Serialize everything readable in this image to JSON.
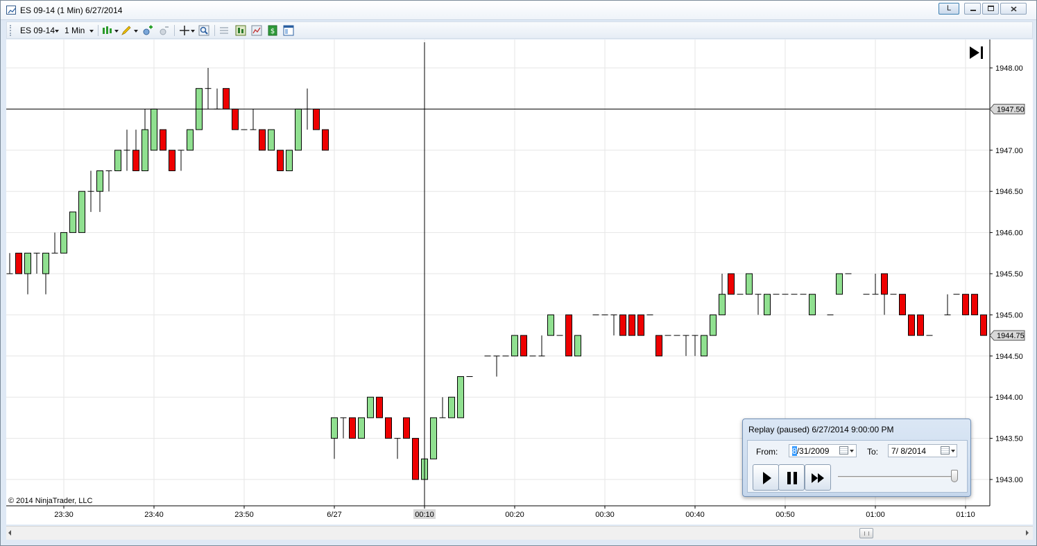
{
  "window": {
    "title": "ES 09-14 (1 Min)  6/27/2014",
    "buttons": {
      "layout": "L"
    }
  },
  "toolbar": {
    "instrument": "ES 09-14",
    "interval": "1 Min",
    "icons": [
      "chart-style-icon",
      "drawing-pencil-icon",
      "add-indicator-icon",
      "remove-indicator-icon",
      "crosshair-icon",
      "zoom-icon",
      "properties-icon",
      "data-box-icon",
      "strategy-icon",
      "money-icon",
      "layout-icon"
    ]
  },
  "chart": {
    "copyright": "© 2014 NinjaTrader, LLC",
    "price_labels": [
      "1948.00",
      "1947.50",
      "1947.00",
      "1946.50",
      "1946.00",
      "1945.50",
      "1945.00",
      "1944.50",
      "1944.00",
      "1943.50",
      "1943.00"
    ],
    "time_labels": [
      "23:30",
      "23:40",
      "23:50",
      "6/27",
      "00:10",
      "00:20",
      "00:30",
      "00:40",
      "00:50",
      "01:00",
      "01:10"
    ],
    "crosshair_price": "1947.50",
    "last_price": "1944.75",
    "colors": {
      "up": "#90e090",
      "down": "#ee0000",
      "grid": "#e6e6e6",
      "crosshair": "#000000"
    }
  },
  "chart_data": {
    "type": "candlestick",
    "instrument": "ES 09-14",
    "interval": "1 Min",
    "ylim": [
      1942.75,
      1948.25
    ],
    "bars": [
      {
        "t": "23:24",
        "o": 1945.5,
        "h": 1945.75,
        "l": 1945.5,
        "c": 1945.5
      },
      {
        "t": "23:25",
        "o": 1945.75,
        "h": 1945.75,
        "l": 1945.5,
        "c": 1945.5
      },
      {
        "t": "23:26",
        "o": 1945.5,
        "h": 1945.75,
        "l": 1945.25,
        "c": 1945.75
      },
      {
        "t": "23:27",
        "o": 1945.75,
        "h": 1945.75,
        "l": 1945.5,
        "c": 1945.75
      },
      {
        "t": "23:28",
        "o": 1945.5,
        "h": 1945.75,
        "l": 1945.25,
        "c": 1945.75
      },
      {
        "t": "23:29",
        "o": 1945.75,
        "h": 1946.0,
        "l": 1945.75,
        "c": 1945.75
      },
      {
        "t": "23:30",
        "o": 1945.75,
        "h": 1946.0,
        "l": 1945.75,
        "c": 1946.0
      },
      {
        "t": "23:31",
        "o": 1946.0,
        "h": 1946.25,
        "l": 1946.0,
        "c": 1946.25
      },
      {
        "t": "23:32",
        "o": 1946.0,
        "h": 1946.5,
        "l": 1946.0,
        "c": 1946.5
      },
      {
        "t": "23:33",
        "o": 1946.5,
        "h": 1946.75,
        "l": 1946.25,
        "c": 1946.5
      },
      {
        "t": "23:34",
        "o": 1946.5,
        "h": 1946.75,
        "l": 1946.25,
        "c": 1946.75
      },
      {
        "t": "23:35",
        "o": 1946.75,
        "h": 1946.75,
        "l": 1946.5,
        "c": 1946.75
      },
      {
        "t": "23:36",
        "o": 1946.75,
        "h": 1947.0,
        "l": 1946.75,
        "c": 1947.0
      },
      {
        "t": "23:37",
        "o": 1947.0,
        "h": 1947.25,
        "l": 1946.75,
        "c": 1947.0
      },
      {
        "t": "23:38",
        "o": 1947.0,
        "h": 1947.25,
        "l": 1946.75,
        "c": 1946.75
      },
      {
        "t": "23:39",
        "o": 1946.75,
        "h": 1947.5,
        "l": 1946.75,
        "c": 1947.25
      },
      {
        "t": "23:40",
        "o": 1947.0,
        "h": 1947.5,
        "l": 1947.0,
        "c": 1947.5
      },
      {
        "t": "23:41",
        "o": 1947.25,
        "h": 1947.25,
        "l": 1947.0,
        "c": 1947.0
      },
      {
        "t": "23:42",
        "o": 1947.0,
        "h": 1947.0,
        "l": 1946.75,
        "c": 1946.75
      },
      {
        "t": "23:43",
        "o": 1947.0,
        "h": 1947.0,
        "l": 1946.75,
        "c": 1947.0
      },
      {
        "t": "23:44",
        "o": 1947.0,
        "h": 1947.25,
        "l": 1947.0,
        "c": 1947.25
      },
      {
        "t": "23:45",
        "o": 1947.25,
        "h": 1947.75,
        "l": 1947.25,
        "c": 1947.75
      },
      {
        "t": "23:46",
        "o": 1947.75,
        "h": 1948.0,
        "l": 1947.5,
        "c": 1947.75
      },
      {
        "t": "23:47",
        "o": 1947.5,
        "h": 1947.75,
        "l": 1947.5,
        "c": 1947.5
      },
      {
        "t": "23:48",
        "o": 1947.75,
        "h": 1947.75,
        "l": 1947.5,
        "c": 1947.5
      },
      {
        "t": "23:49",
        "o": 1947.5,
        "h": 1947.5,
        "l": 1947.25,
        "c": 1947.25
      },
      {
        "t": "23:50",
        "o": 1947.25,
        "h": 1947.25,
        "l": 1947.25,
        "c": 1947.25
      },
      {
        "t": "23:51",
        "o": 1947.25,
        "h": 1947.5,
        "l": 1947.25,
        "c": 1947.25
      },
      {
        "t": "23:52",
        "o": 1947.25,
        "h": 1947.25,
        "l": 1947.0,
        "c": 1947.0
      },
      {
        "t": "23:53",
        "o": 1947.0,
        "h": 1947.25,
        "l": 1947.0,
        "c": 1947.25
      },
      {
        "t": "23:54",
        "o": 1947.0,
        "h": 1947.0,
        "l": 1946.75,
        "c": 1946.75
      },
      {
        "t": "23:55",
        "o": 1946.75,
        "h": 1947.0,
        "l": 1946.75,
        "c": 1947.0
      },
      {
        "t": "23:56",
        "o": 1947.0,
        "h": 1947.5,
        "l": 1947.0,
        "c": 1947.5
      },
      {
        "t": "23:57",
        "o": 1947.5,
        "h": 1947.75,
        "l": 1947.25,
        "c": 1947.5
      },
      {
        "t": "23:58",
        "o": 1947.5,
        "h": 1947.5,
        "l": 1947.25,
        "c": 1947.25
      },
      {
        "t": "23:59",
        "o": 1947.25,
        "h": 1947.25,
        "l": 1947.0,
        "c": 1947.0
      },
      {
        "t": "00:00",
        "o": 1943.5,
        "h": 1943.75,
        "l": 1943.25,
        "c": 1943.75
      },
      {
        "t": "00:01",
        "o": 1943.75,
        "h": 1943.75,
        "l": 1943.5,
        "c": 1943.75
      },
      {
        "t": "00:02",
        "o": 1943.75,
        "h": 1943.75,
        "l": 1943.5,
        "c": 1943.5
      },
      {
        "t": "00:03",
        "o": 1943.5,
        "h": 1943.75,
        "l": 1943.5,
        "c": 1943.75
      },
      {
        "t": "00:04",
        "o": 1943.75,
        "h": 1944.0,
        "l": 1943.75,
        "c": 1944.0
      },
      {
        "t": "00:05",
        "o": 1944.0,
        "h": 1944.0,
        "l": 1943.75,
        "c": 1943.75
      },
      {
        "t": "00:06",
        "o": 1943.75,
        "h": 1943.75,
        "l": 1943.5,
        "c": 1943.5
      },
      {
        "t": "00:07",
        "o": 1943.5,
        "h": 1943.5,
        "l": 1943.25,
        "c": 1943.5
      },
      {
        "t": "00:08",
        "o": 1943.75,
        "h": 1943.75,
        "l": 1943.5,
        "c": 1943.5
      },
      {
        "t": "00:09",
        "o": 1943.5,
        "h": 1943.5,
        "l": 1943.0,
        "c": 1943.0
      },
      {
        "t": "00:10",
        "o": 1943.0,
        "h": 1943.25,
        "l": 1943.0,
        "c": 1943.25
      },
      {
        "t": "00:11",
        "o": 1943.25,
        "h": 1943.75,
        "l": 1943.25,
        "c": 1943.75
      },
      {
        "t": "00:12",
        "o": 1943.75,
        "h": 1944.0,
        "l": 1943.75,
        "c": 1943.75
      },
      {
        "t": "00:13",
        "o": 1943.75,
        "h": 1944.0,
        "l": 1943.75,
        "c": 1944.0
      },
      {
        "t": "00:14",
        "o": 1943.75,
        "h": 1944.25,
        "l": 1943.75,
        "c": 1944.25
      },
      {
        "t": "00:15",
        "o": 1944.25,
        "h": 1944.25,
        "l": 1944.25,
        "c": 1944.25
      },
      {
        "t": "00:17",
        "o": 1944.5,
        "h": 1944.5,
        "l": 1944.5,
        "c": 1944.5
      },
      {
        "t": "00:18",
        "o": 1944.5,
        "h": 1944.5,
        "l": 1944.25,
        "c": 1944.5
      },
      {
        "t": "00:19",
        "o": 1944.5,
        "h": 1944.5,
        "l": 1944.5,
        "c": 1944.5
      },
      {
        "t": "00:20",
        "o": 1944.5,
        "h": 1944.75,
        "l": 1944.5,
        "c": 1944.75
      },
      {
        "t": "00:21",
        "o": 1944.75,
        "h": 1944.75,
        "l": 1944.5,
        "c": 1944.5
      },
      {
        "t": "00:22",
        "o": 1944.5,
        "h": 1944.5,
        "l": 1944.5,
        "c": 1944.5
      },
      {
        "t": "00:23",
        "o": 1944.5,
        "h": 1944.75,
        "l": 1944.5,
        "c": 1944.5
      },
      {
        "t": "00:24",
        "o": 1944.75,
        "h": 1945.0,
        "l": 1944.75,
        "c": 1945.0
      },
      {
        "t": "00:25",
        "o": 1944.75,
        "h": 1944.75,
        "l": 1944.75,
        "c": 1944.75
      },
      {
        "t": "00:26",
        "o": 1945.0,
        "h": 1945.0,
        "l": 1944.5,
        "c": 1944.5
      },
      {
        "t": "00:27",
        "o": 1944.5,
        "h": 1944.75,
        "l": 1944.5,
        "c": 1944.75
      },
      {
        "t": "00:29",
        "o": 1945.0,
        "h": 1945.0,
        "l": 1945.0,
        "c": 1945.0
      },
      {
        "t": "00:30",
        "o": 1945.0,
        "h": 1945.0,
        "l": 1945.0,
        "c": 1945.0
      },
      {
        "t": "00:31",
        "o": 1945.0,
        "h": 1945.0,
        "l": 1944.75,
        "c": 1945.0
      },
      {
        "t": "00:32",
        "o": 1945.0,
        "h": 1945.0,
        "l": 1944.75,
        "c": 1944.75
      },
      {
        "t": "00:33",
        "o": 1945.0,
        "h": 1945.0,
        "l": 1944.75,
        "c": 1944.75
      },
      {
        "t": "00:34",
        "o": 1945.0,
        "h": 1945.0,
        "l": 1944.75,
        "c": 1944.75
      },
      {
        "t": "00:35",
        "o": 1945.0,
        "h": 1945.0,
        "l": 1945.0,
        "c": 1945.0
      },
      {
        "t": "00:36",
        "o": 1944.75,
        "h": 1944.75,
        "l": 1944.5,
        "c": 1944.5
      },
      {
        "t": "00:37",
        "o": 1944.75,
        "h": 1944.75,
        "l": 1944.75,
        "c": 1944.75
      },
      {
        "t": "00:38",
        "o": 1944.75,
        "h": 1944.75,
        "l": 1944.75,
        "c": 1944.75
      },
      {
        "t": "00:39",
        "o": 1944.75,
        "h": 1944.75,
        "l": 1944.5,
        "c": 1944.75
      },
      {
        "t": "00:40",
        "o": 1944.75,
        "h": 1944.75,
        "l": 1944.5,
        "c": 1944.75
      },
      {
        "t": "00:41",
        "o": 1944.5,
        "h": 1944.75,
        "l": 1944.5,
        "c": 1944.75
      },
      {
        "t": "00:42",
        "o": 1944.75,
        "h": 1945.0,
        "l": 1944.75,
        "c": 1945.0
      },
      {
        "t": "00:43",
        "o": 1945.0,
        "h": 1945.5,
        "l": 1945.0,
        "c": 1945.25
      },
      {
        "t": "00:44",
        "o": 1945.5,
        "h": 1945.5,
        "l": 1945.25,
        "c": 1945.25
      },
      {
        "t": "00:45",
        "o": 1945.25,
        "h": 1945.25,
        "l": 1945.25,
        "c": 1945.25
      },
      {
        "t": "00:46",
        "o": 1945.25,
        "h": 1945.5,
        "l": 1945.25,
        "c": 1945.5
      },
      {
        "t": "00:47",
        "o": 1945.25,
        "h": 1945.25,
        "l": 1945.0,
        "c": 1945.25
      },
      {
        "t": "00:48",
        "o": 1945.0,
        "h": 1945.25,
        "l": 1945.0,
        "c": 1945.25
      },
      {
        "t": "00:49",
        "o": 1945.25,
        "h": 1945.25,
        "l": 1945.25,
        "c": 1945.25
      },
      {
        "t": "00:50",
        "o": 1945.25,
        "h": 1945.25,
        "l": 1945.25,
        "c": 1945.25
      },
      {
        "t": "00:51",
        "o": 1945.25,
        "h": 1945.25,
        "l": 1945.25,
        "c": 1945.25
      },
      {
        "t": "00:52",
        "o": 1945.25,
        "h": 1945.25,
        "l": 1945.25,
        "c": 1945.25
      },
      {
        "t": "00:53",
        "o": 1945.0,
        "h": 1945.25,
        "l": 1945.0,
        "c": 1945.25
      },
      {
        "t": "00:55",
        "o": 1945.0,
        "h": 1945.0,
        "l": 1945.0,
        "c": 1945.0
      },
      {
        "t": "00:56",
        "o": 1945.25,
        "h": 1945.5,
        "l": 1945.25,
        "c": 1945.5
      },
      {
        "t": "00:57",
        "o": 1945.5,
        "h": 1945.5,
        "l": 1945.5,
        "c": 1945.5
      },
      {
        "t": "00:59",
        "o": 1945.25,
        "h": 1945.25,
        "l": 1945.25,
        "c": 1945.25
      },
      {
        "t": "01:00",
        "o": 1945.25,
        "h": 1945.5,
        "l": 1945.25,
        "c": 1945.25
      },
      {
        "t": "01:01",
        "o": 1945.5,
        "h": 1945.5,
        "l": 1945.0,
        "c": 1945.25
      },
      {
        "t": "01:02",
        "o": 1945.25,
        "h": 1945.25,
        "l": 1945.25,
        "c": 1945.25
      },
      {
        "t": "01:03",
        "o": 1945.25,
        "h": 1945.25,
        "l": 1945.0,
        "c": 1945.0
      },
      {
        "t": "01:04",
        "o": 1945.0,
        "h": 1945.0,
        "l": 1944.75,
        "c": 1944.75
      },
      {
        "t": "01:05",
        "o": 1945.0,
        "h": 1945.0,
        "l": 1944.75,
        "c": 1944.75
      },
      {
        "t": "01:06",
        "o": 1944.75,
        "h": 1944.75,
        "l": 1944.75,
        "c": 1944.75
      },
      {
        "t": "01:08",
        "o": 1945.0,
        "h": 1945.25,
        "l": 1945.0,
        "c": 1945.0
      },
      {
        "t": "01:09",
        "o": 1945.25,
        "h": 1945.25,
        "l": 1945.25,
        "c": 1945.25
      },
      {
        "t": "01:10",
        "o": 1945.25,
        "h": 1945.25,
        "l": 1945.0,
        "c": 1945.0
      },
      {
        "t": "01:11",
        "o": 1945.25,
        "h": 1945.25,
        "l": 1945.0,
        "c": 1945.0
      },
      {
        "t": "01:12",
        "o": 1945.0,
        "h": 1945.0,
        "l": 1944.75,
        "c": 1944.75
      },
      {
        "t": "01:13",
        "o": 1944.75,
        "h": 1944.75,
        "l": 1944.75,
        "c": 1944.75
      }
    ]
  },
  "replay": {
    "title": "Replay (paused) 6/27/2014 9:00:00 PM",
    "from_label": "From:",
    "from_value_sel": "8",
    "from_value_rest": "/31/2009",
    "to_label": "To:",
    "to_value": "7/  8/2014",
    "controls": [
      "play-icon",
      "pause-icon",
      "fast-forward-icon"
    ],
    "speed_level": 1.0
  }
}
